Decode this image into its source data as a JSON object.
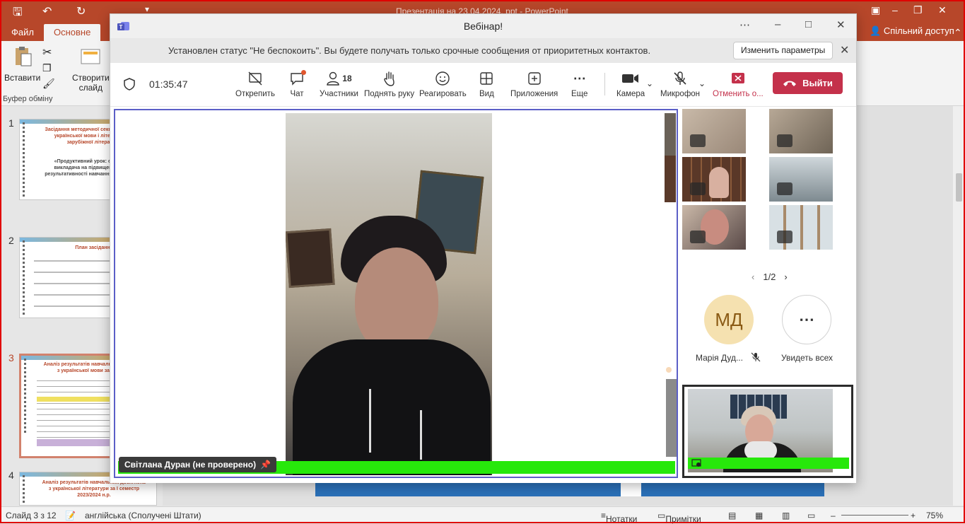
{
  "powerpoint": {
    "title": "Презентація на 23.04.2024. ppt - PowerPoint",
    "tabs": {
      "file": "Файл",
      "home": "Основне"
    },
    "share_label": "Спільний доступ",
    "ribbon": {
      "paste_label": "Вставити",
      "new_slide_label_1": "Створити",
      "new_slide_label_2": "слайд",
      "clipboard_group": "Буфер обміну"
    },
    "thumbnails": [
      {
        "number": "1",
        "title": "Засідання методичної секції викладачів української мови і літератури та зарубіжної літератури",
        "subtitle": "«Продуктивний урок: орієнтація викладача на підвищення якості результативності навчання здобувачів»"
      },
      {
        "number": "2",
        "title": "План засідання"
      },
      {
        "number": "3",
        "title": "Аналіз результатів навчальних досягнень з української мови за І семестр"
      },
      {
        "number": "4",
        "title": "Аналіз результатів навчальних досягнень з української літератури за І семестр 2023/2024 н.р."
      }
    ],
    "status": {
      "slide_info": "Слайд 3 з 12",
      "language": "англійська (Сполучені Штати)",
      "notes": "Нотатки",
      "comments": "Примітки",
      "zoom": "75%"
    },
    "colors": {
      "accent": "#b7472a"
    }
  },
  "teams": {
    "window_title": "Вебінар!",
    "banner": {
      "message": "Установлен статус \"Не беспокоить\". Вы будете получать только срочные сообщения от приоритетных контактов.",
      "change_button": "Изменить параметры"
    },
    "timer": "01:35:47",
    "toolbar": {
      "unpin": "Открепить",
      "chat": "Чат",
      "participants": "Участники",
      "participants_count": "18",
      "raise_hand": "Поднять руку",
      "react": "Реагировать",
      "view": "Вид",
      "apps": "Приложения",
      "more": "Еще",
      "camera": "Камера",
      "microphone": "Микрофон",
      "cancel": "Отменить о...",
      "leave": "Выйти"
    },
    "main_speaker": "Світлана Дуран (не проверено)",
    "pager": "1/2",
    "avatar_initials": "МД",
    "avatar_name": "Марія Дуд...",
    "see_all": "Увидеть всех",
    "colors": {
      "brand": "#5b5fc7",
      "leave": "#c4314b",
      "speaking": "#27e80b"
    }
  }
}
